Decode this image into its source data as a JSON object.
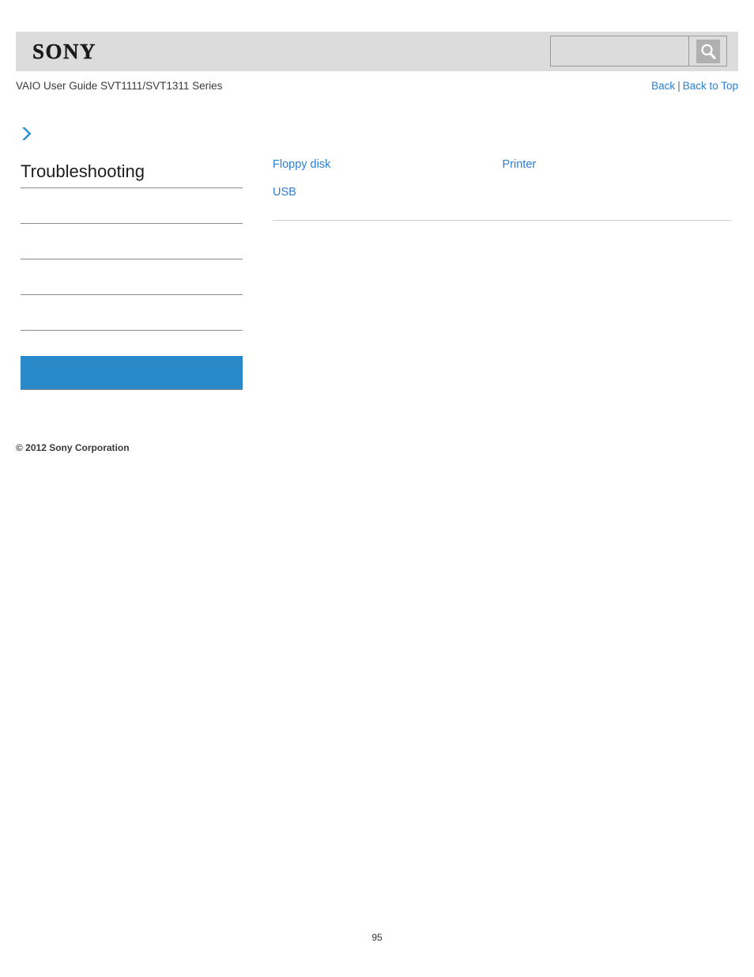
{
  "header": {
    "brand": "SONY",
    "search": {
      "value": "",
      "placeholder": "",
      "button_icon": "search-icon"
    }
  },
  "subheader": {
    "guide_title": "VAIO User Guide SVT1111/SVT1311 Series",
    "back_label": "Back",
    "separator": "|",
    "back_to_top_label": "Back to Top"
  },
  "sidebar": {
    "breadcrumb_icon": "chevron-right-icon",
    "section_title": "Troubleshooting",
    "items": [
      {
        "label": ""
      },
      {
        "label": ""
      },
      {
        "label": ""
      },
      {
        "label": ""
      }
    ],
    "highlight_item": {
      "label": ""
    }
  },
  "main": {
    "links": [
      {
        "label": "Floppy disk"
      },
      {
        "label": "Printer"
      },
      {
        "label": "USB"
      }
    ]
  },
  "footer": {
    "copyright": "© 2012 Sony Corporation",
    "page_number": "95"
  },
  "colors": {
    "link": "#2a7fd4",
    "highlight": "#2989c9",
    "header_bar": "#dcdcdc",
    "rule": "#8c8c8c"
  }
}
